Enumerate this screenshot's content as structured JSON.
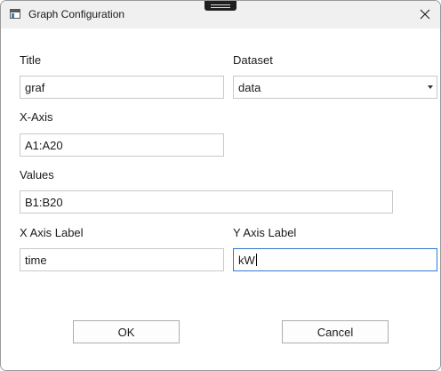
{
  "window": {
    "title": "Graph Configuration",
    "close_icon": "close-icon",
    "app_icon": "window-icon"
  },
  "form": {
    "title": {
      "label": "Title",
      "value": "graf"
    },
    "dataset": {
      "label": "Dataset",
      "selected": "data"
    },
    "x_axis": {
      "label": "X-Axis",
      "value": "A1:A20"
    },
    "values": {
      "label": "Values",
      "value": "B1:B20"
    },
    "x_axis_label": {
      "label": "X Axis Label",
      "value": "time"
    },
    "y_axis_label": {
      "label": "Y Axis Label",
      "value": "kW"
    }
  },
  "buttons": {
    "ok": "OK",
    "cancel": "Cancel"
  },
  "colors": {
    "focus_border": "#2f7bd4",
    "window_bg": "#f0f0f0"
  }
}
